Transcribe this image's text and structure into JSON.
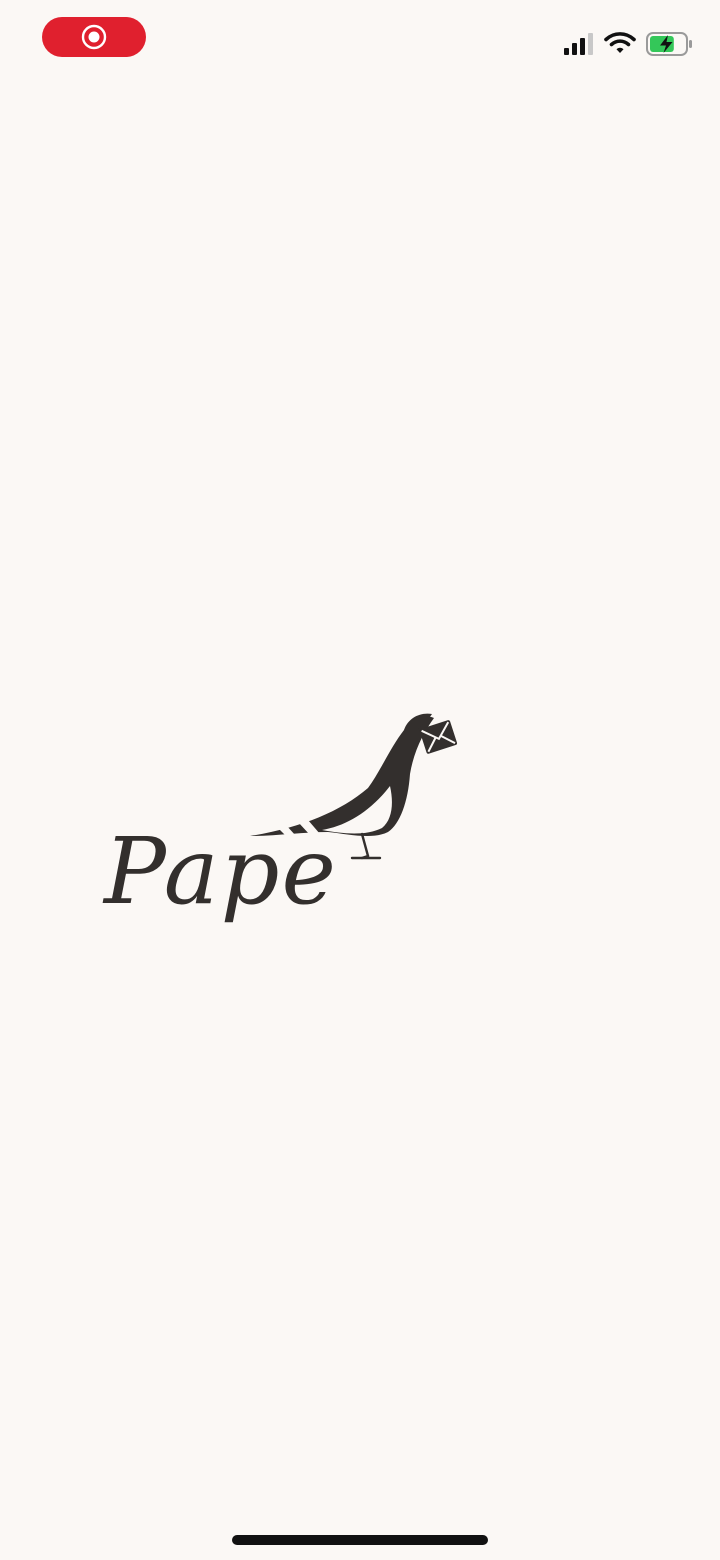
{
  "app": {
    "name": "Pape"
  },
  "status_bar": {
    "record_indicator_color": "#e0202e",
    "signal_bars_active": 3,
    "signal_bars_total": 4,
    "battery_level_percent": 70,
    "battery_charging": true,
    "battery_fill_color": "#34c759",
    "icons": [
      "screen-record-icon",
      "signal-icon",
      "wifi-icon",
      "battery-charging-icon"
    ]
  },
  "splash": {
    "logo_text": "Pape",
    "logo_icon": "carrier-pigeon-with-envelope-icon",
    "logo_color": "#332f2d"
  },
  "colors": {
    "background": "#fbf8f5",
    "ink": "#332f2d",
    "home_indicator": "#111111"
  }
}
